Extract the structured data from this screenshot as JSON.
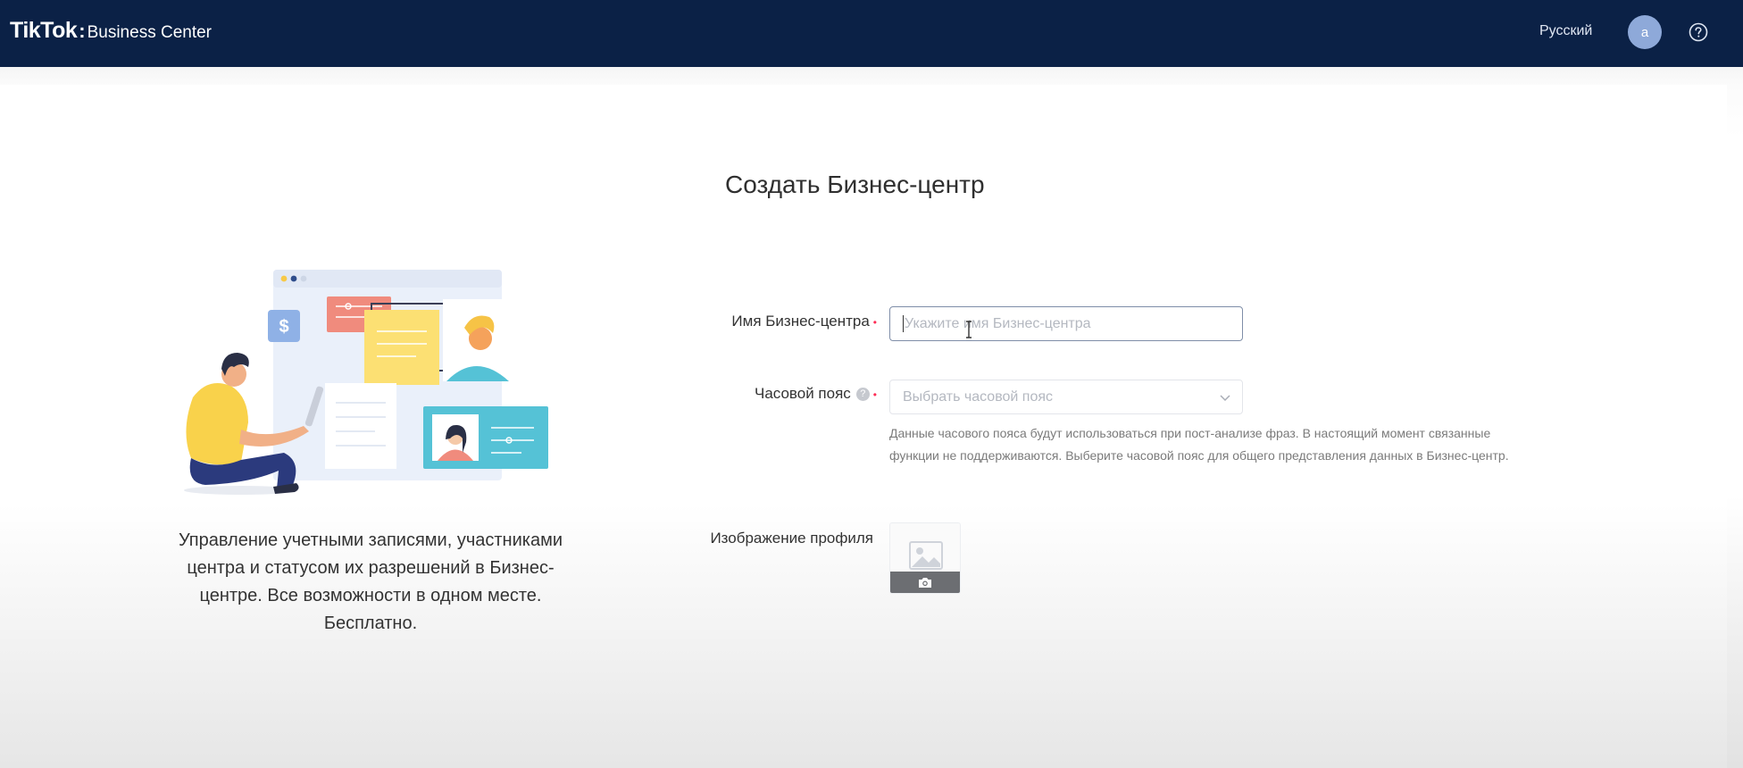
{
  "header": {
    "logo_main": "TikTok",
    "logo_sep": ":",
    "logo_sub": "Business Center",
    "language": "Русский",
    "avatar_initial": "a",
    "help_icon": "help-circle-icon"
  },
  "page": {
    "title": "Создать Бизнес-центр"
  },
  "promo": {
    "text": "Управление учетными записями, участниками центра и статусом их разрешений в Бизнес-центре. Все возможности в одном месте. Бесплатно."
  },
  "form": {
    "name_label": "Имя Бизнес-центра",
    "name_placeholder": "Укажите имя Бизнес-центра",
    "name_value": "",
    "timezone_label": "Часовой пояс",
    "timezone_placeholder": "Выбрать часовой пояс",
    "timezone_hint": "Данные часового пояса будут использоваться при пост-анализе фраз. В настоящий момент связанные функции не поддерживаются. Выберите часовой пояс для общего представления данных в Бизнес-центр.",
    "profile_image_label": "Изображение профиля",
    "required_mark": "•"
  },
  "colors": {
    "header_bg": "#0b2146",
    "required": "#fe2c55",
    "avatar": "#8ea9d9"
  }
}
